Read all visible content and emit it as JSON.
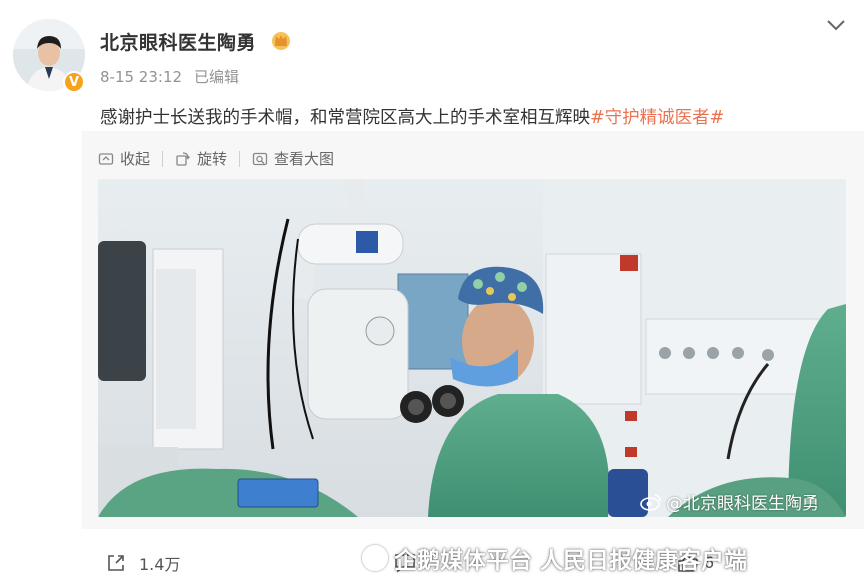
{
  "post": {
    "username": "北京眼科医生陶勇",
    "time": "8-15 23:12",
    "edited": "已编辑",
    "text": "感谢护士长送我的手术帽，和常营院区高大上的手术室相互辉映",
    "hashtag": "#守护精诚医者#",
    "verified_badge": "V"
  },
  "toolbar": {
    "collapse": "收起",
    "rotate": "旋转",
    "view_large": "查看大图"
  },
  "image": {
    "watermark": "@北京眼科医生陶勇"
  },
  "actions": {
    "share_count": "1.4万",
    "like_count": "6"
  },
  "overlay": {
    "source": "企鹅媒体平台 人民日报健康客户端"
  },
  "icons": [
    "avatar",
    "crown-icon",
    "chevron-down-icon",
    "collapse-icon",
    "rotate-icon",
    "view-large-icon",
    "share-icon",
    "comment-icon",
    "like-icon",
    "weibo-logo-icon"
  ],
  "colors": {
    "hashtag": "#eb7350",
    "verified": "#f7a21b",
    "meta": "#939393"
  }
}
